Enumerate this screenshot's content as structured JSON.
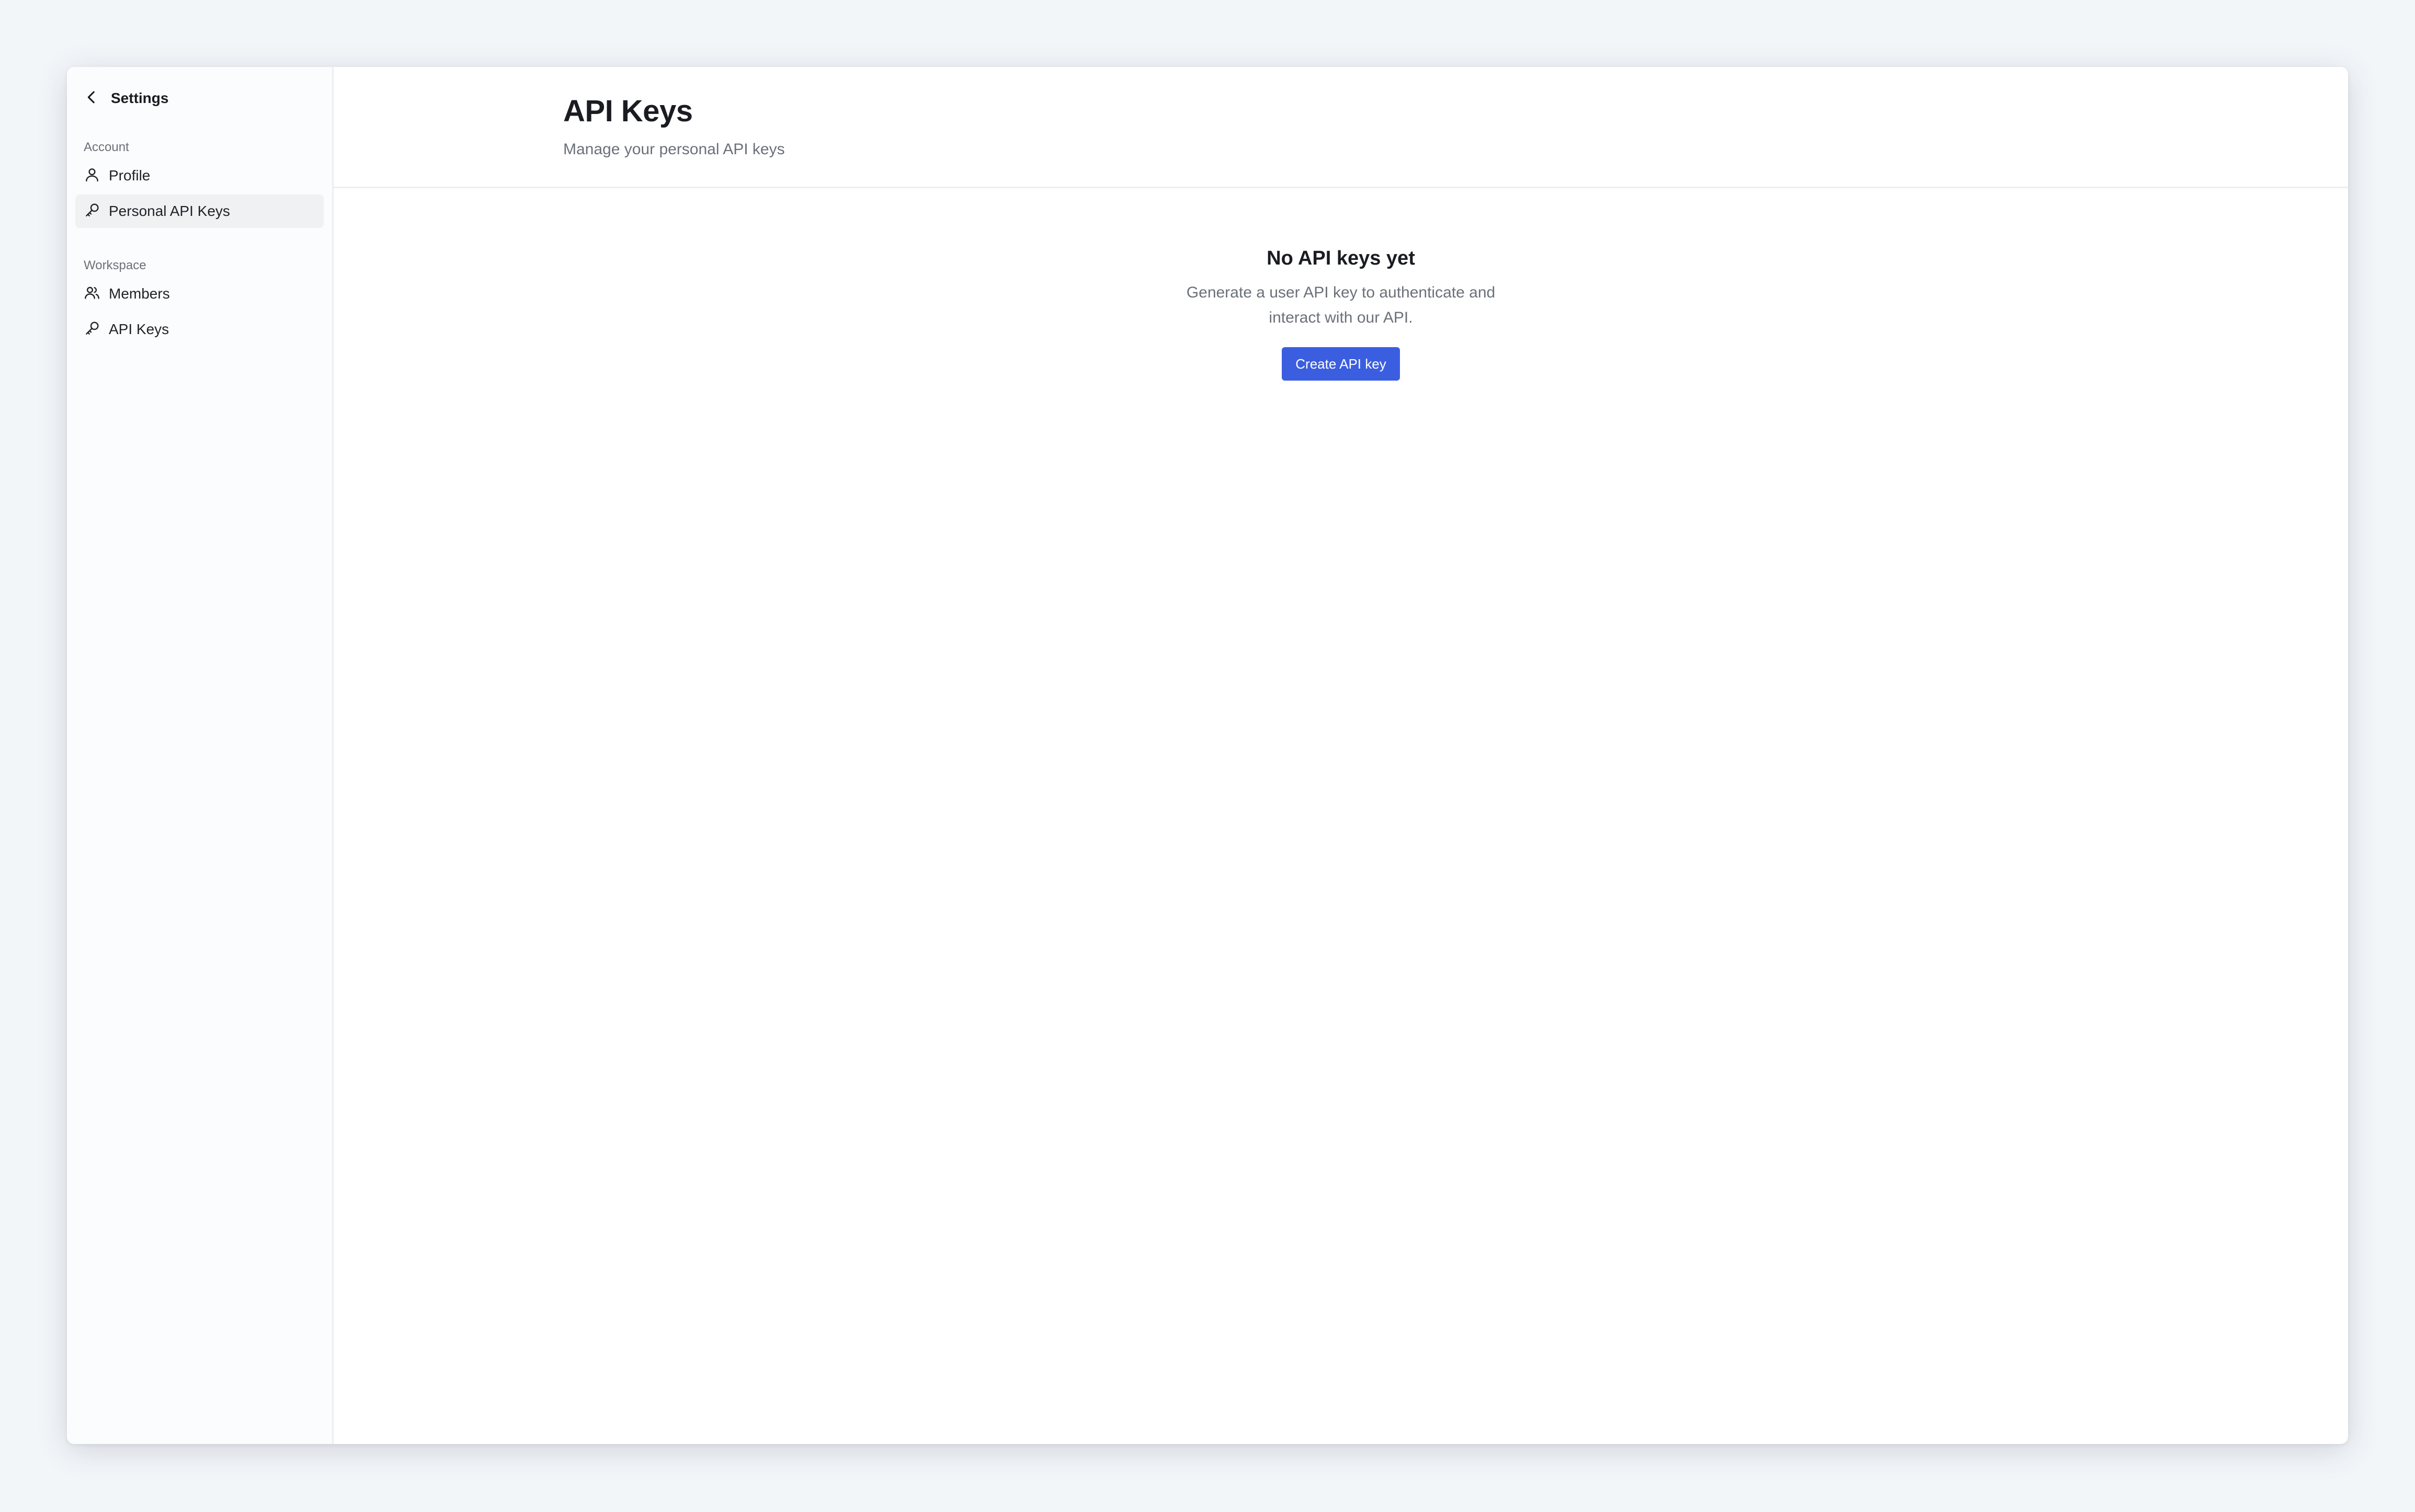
{
  "sidebar": {
    "back_label": "Settings",
    "sections": [
      {
        "label": "Account",
        "items": [
          {
            "label": "Profile",
            "icon": "user-icon",
            "active": false
          },
          {
            "label": "Personal API Keys",
            "icon": "key-icon",
            "active": true
          }
        ]
      },
      {
        "label": "Workspace",
        "items": [
          {
            "label": "Members",
            "icon": "users-icon",
            "active": false
          },
          {
            "label": "API Keys",
            "icon": "key-icon",
            "active": false
          }
        ]
      }
    ]
  },
  "header": {
    "title": "API Keys",
    "subtitle": "Manage your personal API keys"
  },
  "empty_state": {
    "title": "No API keys yet",
    "description": "Generate a user API key to authenticate and interact with our API.",
    "button_label": "Create API key"
  },
  "colors": {
    "accent": "#3b5ee0",
    "background": "#f3f6f9",
    "active_nav": "#f0f1f3"
  }
}
